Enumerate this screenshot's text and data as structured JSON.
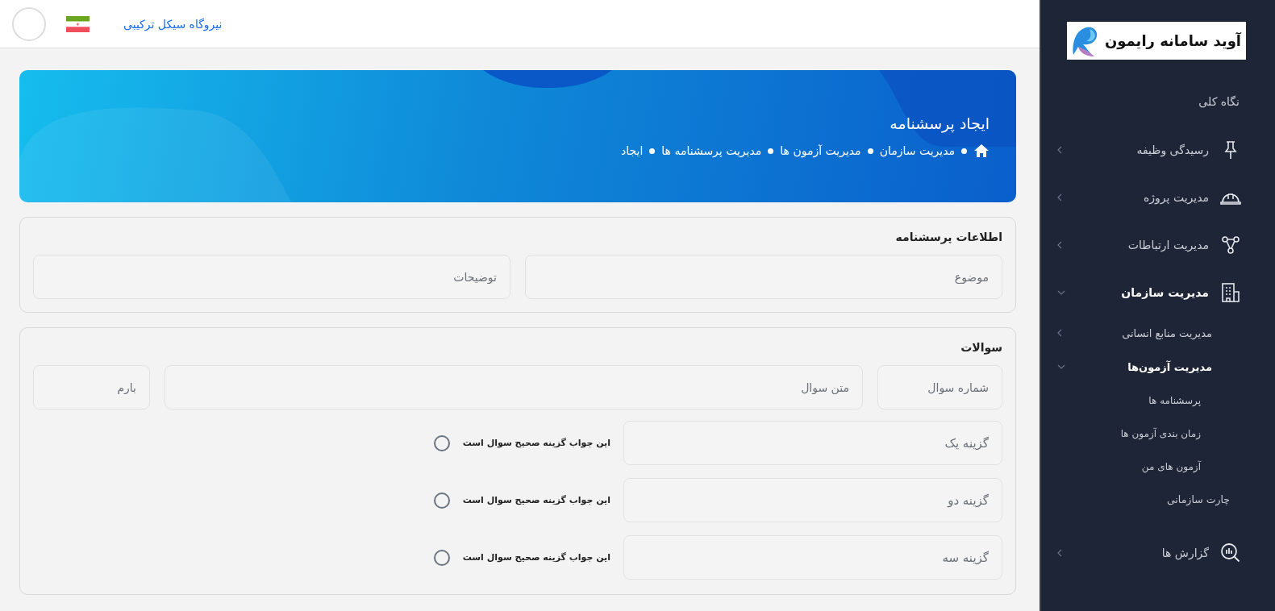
{
  "header": {
    "site_link": "نیروگاه سیکل ترکیبی"
  },
  "banner": {
    "title": "ایجاد پرسشنامه",
    "breadcrumb": [
      "مدیریت سازمان",
      "مدیریت آزمون ها",
      "مدیریت پرسشنامه ها",
      "ایجاد"
    ]
  },
  "info_card": {
    "title": "اطلاعات پرسشنامه",
    "fields": [
      {
        "placeholder": "موضوع"
      },
      {
        "placeholder": "توضیحات"
      }
    ]
  },
  "questions_card": {
    "title": "سوالات",
    "fields": [
      {
        "placeholder": "شماره سوال"
      },
      {
        "placeholder": "متن سوال"
      },
      {
        "placeholder": "بارم"
      }
    ],
    "options": [
      {
        "placeholder": "گزینه یک",
        "correct_label": "این جواب گزینه صحیح سوال است",
        "selected": false
      },
      {
        "placeholder": "گزینه دو",
        "correct_label": "این جواب گزینه صحیح سوال است",
        "selected": false
      },
      {
        "placeholder": "گزینه سه",
        "correct_label": "این جواب گزینه صحیح سوال است",
        "selected": false
      }
    ]
  },
  "sidebar": {
    "logo_text": "آوید سامانه رایمون",
    "items": [
      {
        "label": "نگاه کلی"
      },
      {
        "label": "رسیدگی وظیفه",
        "expanded": false
      },
      {
        "label": "مدیریت پروژه",
        "expanded": false
      },
      {
        "label": "مدیریت ارتباطات",
        "expanded": false
      },
      {
        "label": "مدیریت سازمان",
        "expanded": true,
        "children": [
          {
            "label": "مدیریت منابع انسانی",
            "expanded": false
          },
          {
            "label": "مدیریت آزمون‌ها",
            "expanded": true,
            "children": [
              {
                "label": "پرسشنامه ها"
              },
              {
                "label": "زمان بندی آزمون ها"
              },
              {
                "label": "آزمون های من"
              }
            ]
          },
          {
            "label": "چارت سازمانی"
          }
        ]
      },
      {
        "label": "گزارش ها",
        "expanded": false
      }
    ]
  }
}
